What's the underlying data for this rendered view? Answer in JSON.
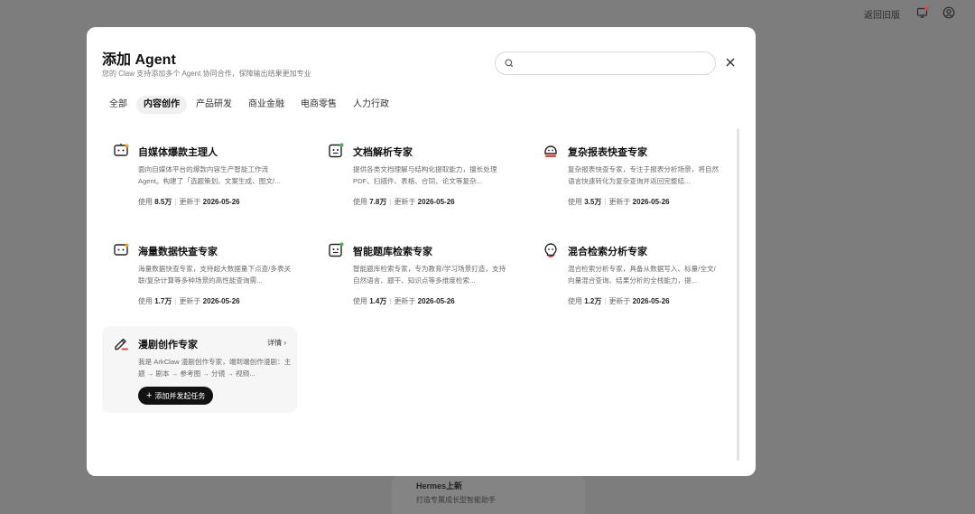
{
  "topbar": {
    "back_link": "返回旧版",
    "icons": [
      "monitor-notification-icon",
      "user-account-icon"
    ],
    "notification_color": "#e0443e"
  },
  "background": {
    "card_title": "Hermes上新",
    "card_subtitle": "打造专属成长型智能助手"
  },
  "modal": {
    "title": "添加 Agent",
    "subtitle": "您的 Claw 支持添加多个 Agent 协同合作，保障输出结果更加专业",
    "search": {
      "placeholder": "",
      "value": ""
    },
    "tabs": [
      {
        "label": "全部",
        "active": false
      },
      {
        "label": "内容创作",
        "active": true
      },
      {
        "label": "产品研发",
        "active": false
      },
      {
        "label": "商业金融",
        "active": false
      },
      {
        "label": "电商零售",
        "active": false
      },
      {
        "label": "人力行政",
        "active": false
      }
    ],
    "cards": [
      {
        "title": "自媒体爆款主理人",
        "desc": "面向自媒体平台的爆款内容生产智能工作流 Agent。构建了「选题策划、文案生成、图文/...",
        "uses_label": "使用",
        "uses": "8.5万",
        "updated_label": "更新于",
        "updated": "2026-05-26",
        "icon": "robot-icon"
      },
      {
        "title": "文档解析专家",
        "desc": "提供各类文档理解与结构化提取能力，擅长处理 PDF、扫描件、表格、合同、论文等复杂...",
        "uses_label": "使用",
        "uses": "7.8万",
        "updated_label": "更新于",
        "updated": "2026-05-26",
        "icon": "doc-robot-icon"
      },
      {
        "title": "复杂报表快查专家",
        "desc": "复杂报表快查专家，专注于报表分析场景，将自然语言快速转化为复杂查询并返回完整结...",
        "uses_label": "使用",
        "uses": "3.5万",
        "updated_label": "更新于",
        "updated": "2026-05-26",
        "icon": "report-robot-icon"
      },
      {
        "title": "海量数据快查专家",
        "desc": "海量数据快查专家，支持超大数据量下点查/多表关联/复杂计算等多种场景的高性能查询需...",
        "uses_label": "使用",
        "uses": "1.7万",
        "updated_label": "更新于",
        "updated": "2026-05-26",
        "icon": "robot-icon"
      },
      {
        "title": "智能题库检索专家",
        "desc": "智能题库检索专家，专为教育/学习场景打造，支持自然语言、题干、知识点等多维度检索...",
        "uses_label": "使用",
        "uses": "1.4万",
        "updated_label": "更新于",
        "updated": "2026-05-26",
        "icon": "doc-robot-icon"
      },
      {
        "title": "混合检索分析专家",
        "desc": "混合检索分析专家，具备从数据写入、标量/全文/向量混合查询、结果分析的全栈能力，提...",
        "uses_label": "使用",
        "uses": "1.2万",
        "updated_label": "更新于",
        "updated": "2026-05-26",
        "icon": "lightbulb-robot-icon"
      }
    ],
    "featured_card": {
      "title": "漫剧创作专家",
      "detail_label": "详情",
      "desc": "我是 ArkClaw 漫剧创作专家，端到端创作漫剧：主题 → 剧本 → 参考图 → 分镜 → 视频...",
      "add_button": "添加并发起任务",
      "icon": "pen-icon"
    }
  },
  "colors": {
    "accent_dark": "#121212",
    "icon_red": "#e0443e",
    "icon_green": "#3cb84a"
  }
}
